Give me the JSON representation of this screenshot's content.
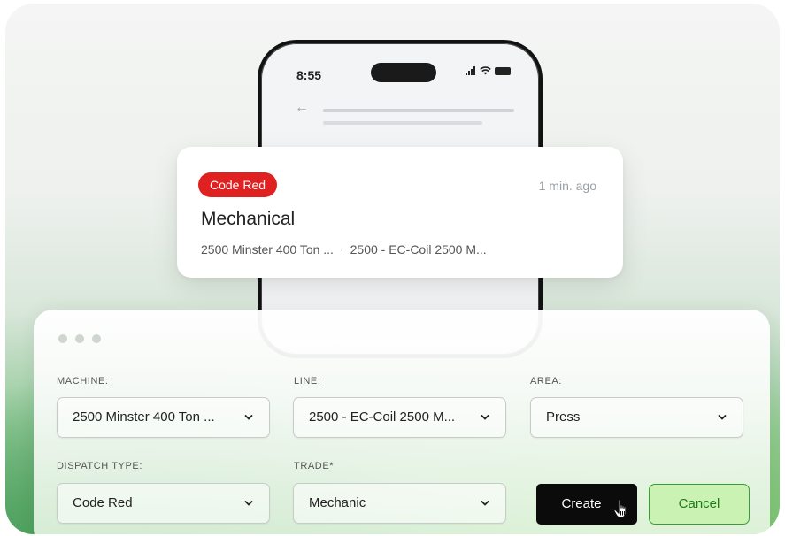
{
  "phone": {
    "time": "8:55"
  },
  "notification": {
    "badge": "Code Red",
    "time_ago": "1 min. ago",
    "title": "Mechanical",
    "machine": "2500 Minster 400 Ton ...",
    "separator": "·",
    "line": "2500 - EC-Coil 2500 M..."
  },
  "form": {
    "machine": {
      "label": "MACHINE:",
      "value": "2500 Minster 400 Ton ..."
    },
    "line": {
      "label": "LINE:",
      "value": "2500 - EC-Coil 2500 M..."
    },
    "area": {
      "label": "AREA:",
      "value": "Press"
    },
    "dispatch_type": {
      "label": "DISPATCH TYPE:",
      "value": "Code Red"
    },
    "trade": {
      "label": "TRADE*",
      "value": "Mechanic"
    },
    "create_label": "Create",
    "cancel_label": "Cancel"
  },
  "colors": {
    "badge": "#e02121",
    "create_button": "#0b0b0b",
    "cancel_button": "#c9f2b3",
    "cancel_text": "#1c7a1c"
  }
}
